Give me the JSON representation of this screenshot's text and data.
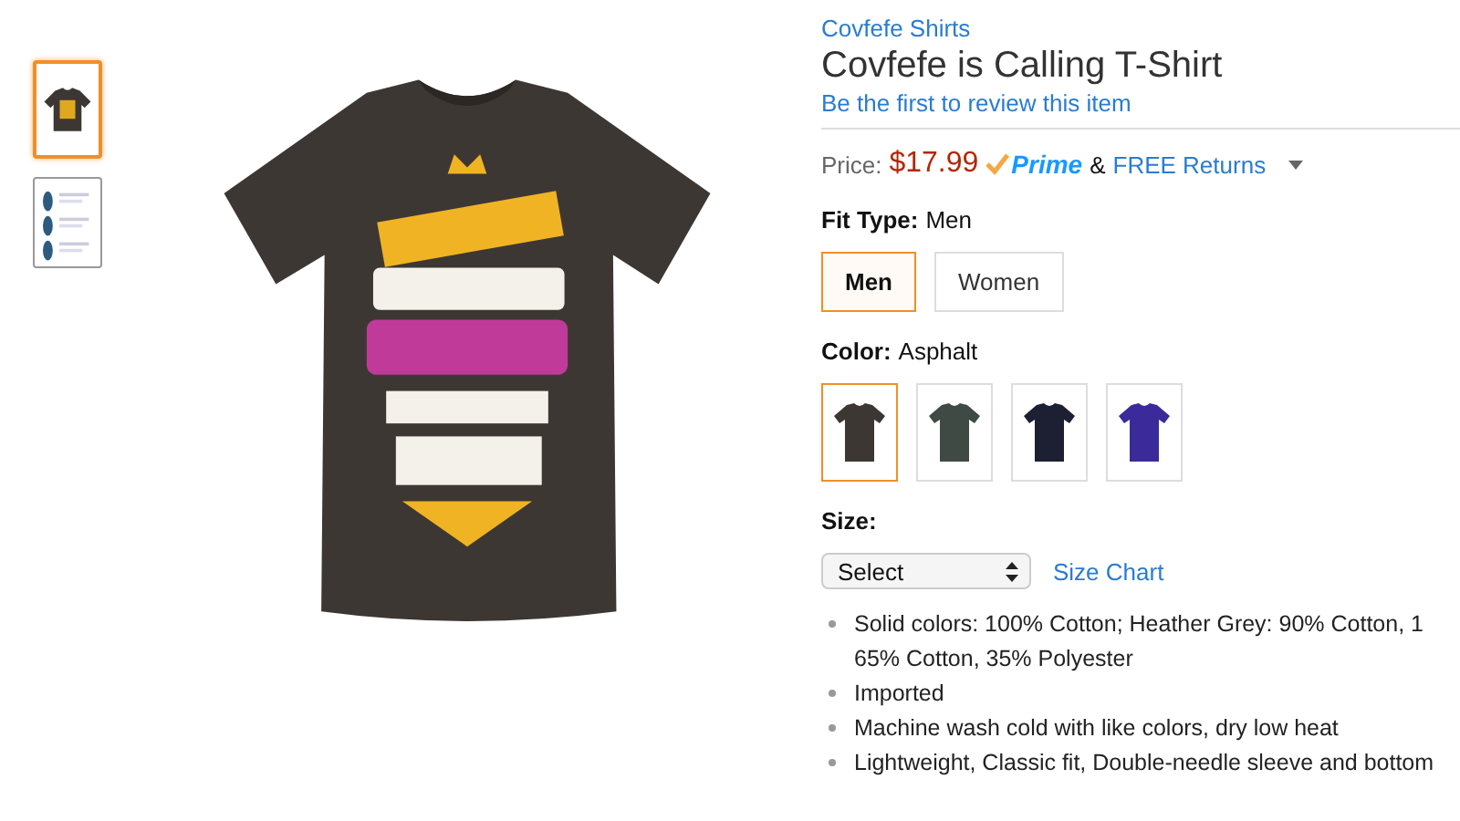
{
  "thumbnails": [
    {
      "kind": "shirt",
      "selected": true
    },
    {
      "kind": "chart",
      "selected": false
    }
  ],
  "product": {
    "brand": "Covfefe Shirts",
    "title": "Covfefe is Calling T-Shirt",
    "review_link": "Be the first to review this item",
    "price_label": "Price:",
    "price": "$17.99",
    "prime": "Prime",
    "ampersand": "&",
    "returns": "FREE Returns",
    "fit_type": {
      "label": "Fit Type:",
      "value": "Men",
      "options": [
        {
          "label": "Men",
          "selected": true
        },
        {
          "label": "Women",
          "selected": false
        }
      ]
    },
    "color": {
      "label": "Color:",
      "value": "Asphalt",
      "swatches": [
        {
          "color": "#3d3733",
          "selected": true
        },
        {
          "color": "#3f4a44",
          "selected": false
        },
        {
          "color": "#1d1f33",
          "selected": false
        },
        {
          "color": "#3a2a9a",
          "selected": false
        }
      ]
    },
    "size": {
      "label": "Size:",
      "select": "Select",
      "chart_link": "Size Chart"
    },
    "bullets": [
      {
        "lines": [
          "Solid colors: 100% Cotton; Heather Grey: 90% Cotton, 1",
          "65% Cotton, 35% Polyester"
        ]
      },
      {
        "lines": [
          "Imported"
        ]
      },
      {
        "lines": [
          "Machine wash cold with like colors, dry low heat"
        ]
      },
      {
        "lines": [
          "Lightweight, Classic fit, Double-needle sleeve and bottom"
        ]
      }
    ]
  }
}
